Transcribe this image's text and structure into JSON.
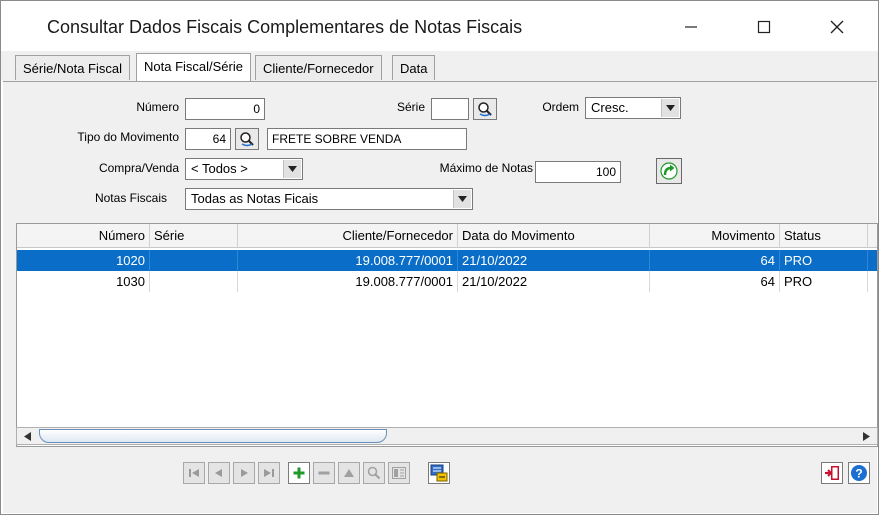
{
  "window": {
    "title": "Consultar Dados Fiscais Complementares de Notas Fiscais",
    "minimize_icon": "minimize-icon",
    "maximize_icon": "maximize-icon",
    "close_icon": "close-icon"
  },
  "tabs": [
    {
      "label": "Série/Nota Fiscal",
      "active": false
    },
    {
      "label": "Nota Fiscal/Série",
      "active": true
    },
    {
      "label": "Cliente/Fornecedor",
      "active": false
    },
    {
      "label": "Data",
      "active": false
    }
  ],
  "form": {
    "numero_label": "Número",
    "numero_value": "0",
    "serie_label": "Série",
    "serie_value": "",
    "ordem_label": "Ordem",
    "ordem_value": "Cresc.",
    "tipo_label": "Tipo do Movimento",
    "tipo_value": "64",
    "tipo_desc": "FRETE SOBRE VENDA",
    "compra_label": "Compra/Venda",
    "compra_value": "< Todos >",
    "maximo_label": "Máximo de Notas",
    "maximo_value": "100",
    "notas_label": "Notas Fiscais",
    "notas_value": "Todas as Notas Ficais"
  },
  "grid": {
    "columns": [
      "Número",
      "Série",
      "Cliente/Fornecedor",
      "Data do Movimento",
      "Movimento",
      "Status"
    ],
    "rows": [
      {
        "numero": "1020",
        "serie": "",
        "cliente": "19.008.777/0001",
        "data": "21/10/2022",
        "movimento": "64",
        "status": "PRO",
        "selected": true
      },
      {
        "numero": "1030",
        "serie": "",
        "cliente": "19.008.777/0001",
        "data": "21/10/2022",
        "movimento": "64",
        "status": "PRO",
        "selected": false
      }
    ]
  },
  "colors": {
    "selection": "#0a6ec8",
    "add_button": "#1e9a2a",
    "exit_button": "#c8102e",
    "help_button": "#1b6fd1"
  }
}
